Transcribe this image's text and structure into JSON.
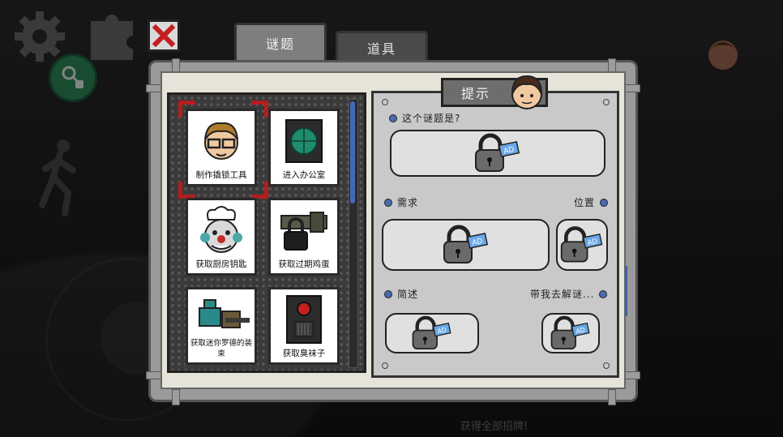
{
  "tabs": [
    {
      "label": "谜题",
      "active": true
    },
    {
      "label": "道具",
      "active": false
    }
  ],
  "puzzles": [
    {
      "label": "制作撬锁工具",
      "icon": "nerd-face-icon",
      "selected": true
    },
    {
      "label": "进入办公室",
      "icon": "green-safe-icon",
      "selected": false
    },
    {
      "label": "获取厨房钥匙",
      "icon": "chef-clown-icon",
      "selected": false
    },
    {
      "label": "获取过期鸡蛋",
      "icon": "padlock-hasp-icon",
      "selected": false
    },
    {
      "label": "获取迷你罗德的装束",
      "icon": "mini-rod-outfit-icon",
      "selected": false
    },
    {
      "label": "获取臭袜子",
      "icon": "red-button-box-icon",
      "selected": false
    }
  ],
  "hint": {
    "title": "提示",
    "question_label": "这个谜题是?",
    "need_label": "需求",
    "location_label": "位置",
    "describe_label": "简述",
    "take_me_label": "带我去解谜...",
    "lock_icon": "locked-ad-icon"
  },
  "footer_text": "获得全部招牌!",
  "colors": {
    "accent_blue": "#4468b8",
    "selection_red": "#b41d1d",
    "key_button": "#2e8a5a"
  }
}
